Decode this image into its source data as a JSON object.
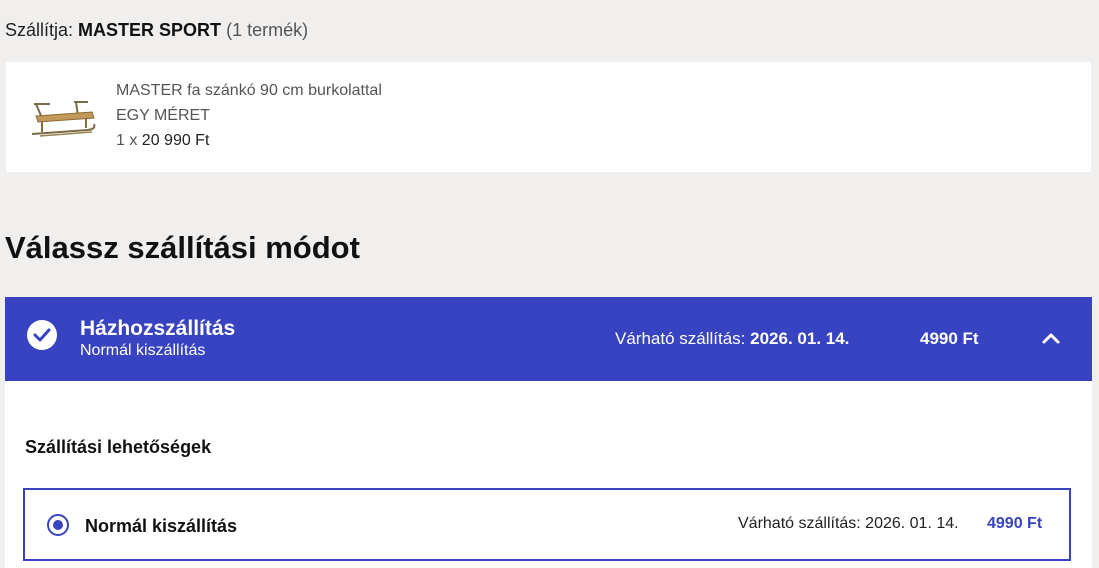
{
  "seller": {
    "prefix": "Szállítja:",
    "name": "MASTER SPORT",
    "count": "(1 termék)"
  },
  "product": {
    "title": "MASTER fa szánkó 90 cm burkolattal",
    "size": "EGY MÉRET",
    "qty": "1 x",
    "price": "20 990 Ft",
    "thumbnail_icon": "wooden-sled-image"
  },
  "shipping": {
    "section_title": "Válassz szállítási módot",
    "method": {
      "name": "Házhozszállítás",
      "subtitle": "Normál kiszállítás",
      "eta_label": "Várható szállítás:",
      "eta_date": "2026. 01. 14.",
      "price": "4990 Ft",
      "icon": "check-circle-icon",
      "toggle_icon": "chevron-up-icon"
    },
    "options_title": "Szállítási lehetőségek",
    "options": [
      {
        "label": "Normál kiszállítás",
        "eta": "Várható szállítás: 2026. 01. 14.",
        "price": "4990 Ft",
        "selected": true
      }
    ]
  },
  "colors": {
    "accent": "#3743c0",
    "background": "#f0efee",
    "card": "#ffffff"
  }
}
